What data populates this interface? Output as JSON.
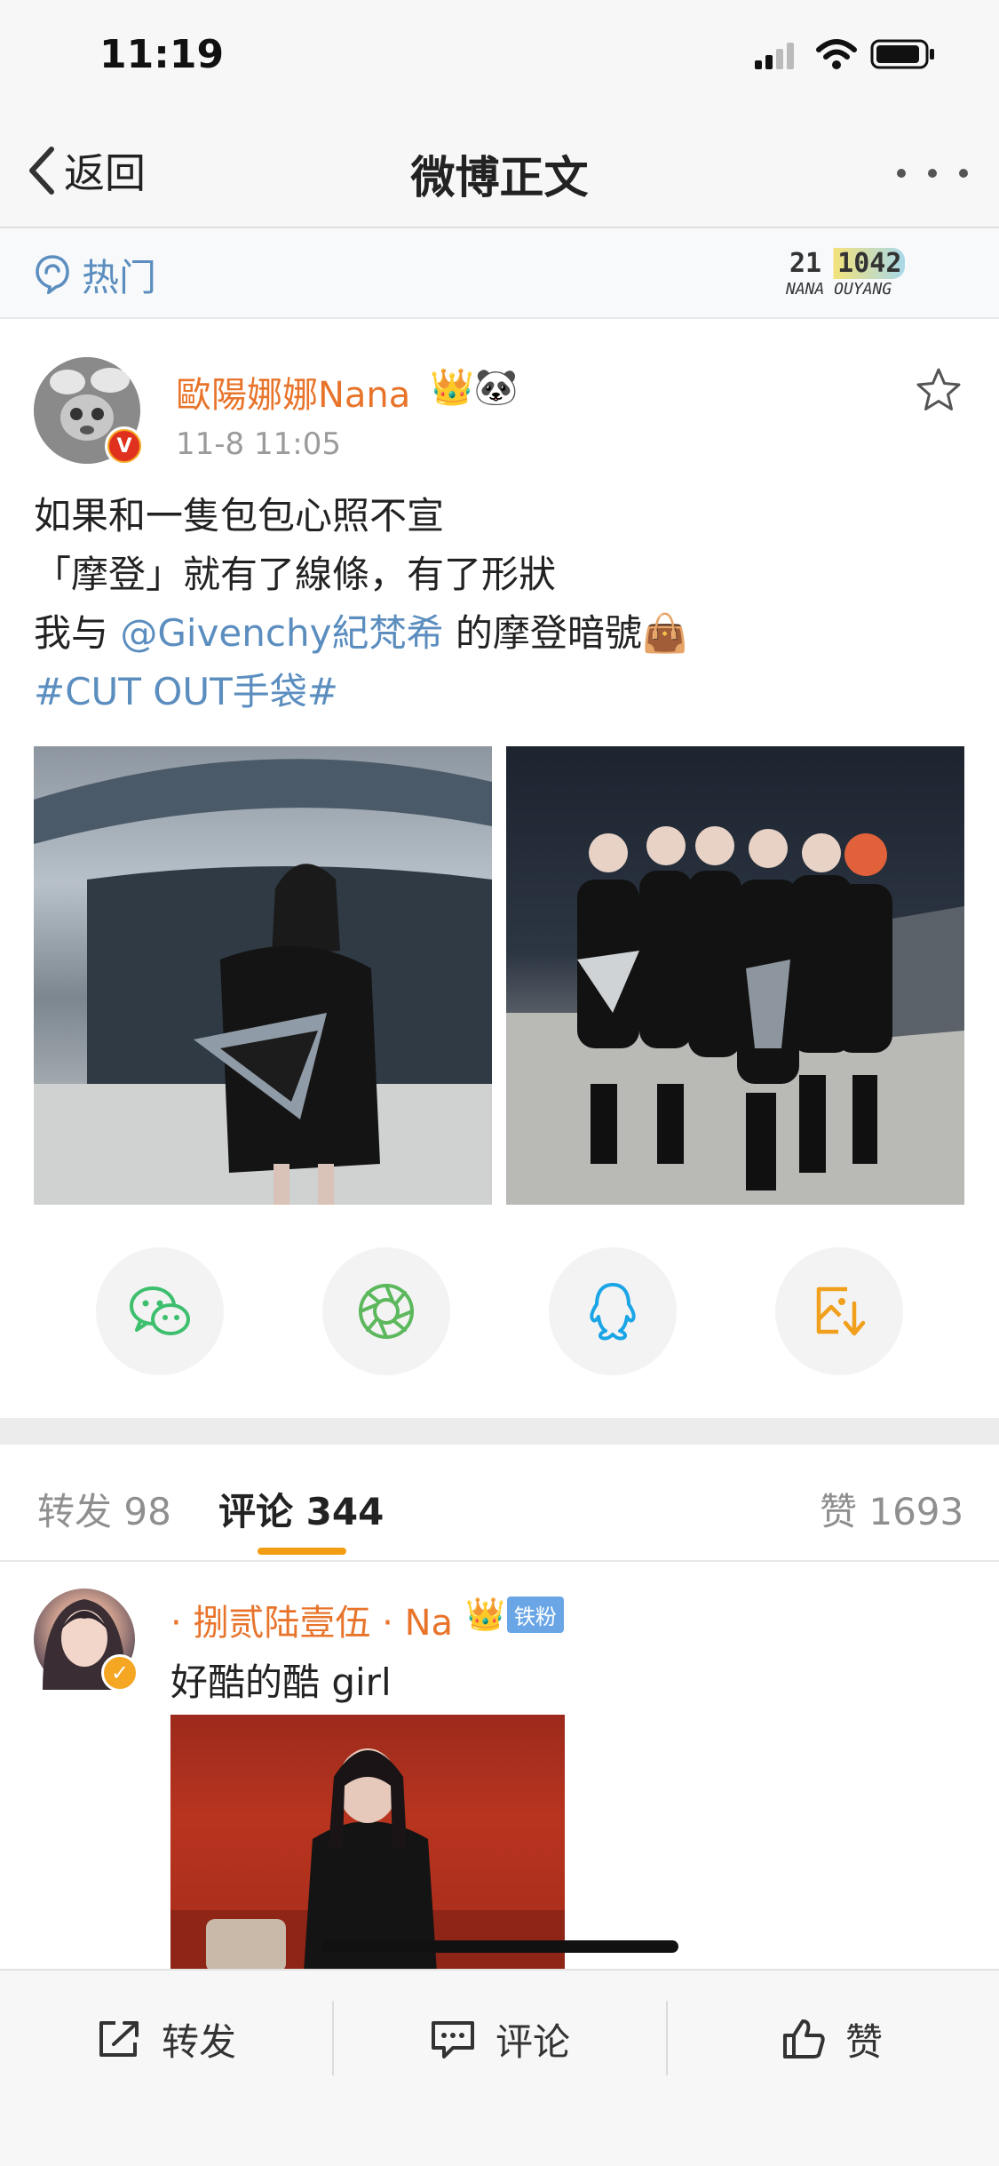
{
  "status_bar": {
    "time": "11:19"
  },
  "nav": {
    "back_label": "返回",
    "title": "微博正文"
  },
  "hot_bar": {
    "label": "热门",
    "badge_top": "21 1042",
    "badge_bottom": "NANA OUYANG"
  },
  "post": {
    "author": "歐陽娜娜Nana",
    "author_icons": "👑🐼",
    "time": "11-8 11:05",
    "line1": "如果和一隻包包心照不宣",
    "line2": "「摩登」就有了線條，有了形狀",
    "line3_prefix": "我与 ",
    "line3_mention": "@Givenchy紀梵希",
    "line3_suffix": " 的摩登暗號👜",
    "hashtag": "#CUT OUT手袋#"
  },
  "tabs": {
    "repost_label": "转发 98",
    "comment_label": "评论 344",
    "like_label": "赞 1693"
  },
  "comment": {
    "name": "· 捌贰陆壹伍 · Na",
    "crown": "👑",
    "fan_badge": "铁粉",
    "text": "好酷的酷 girl"
  },
  "bottom_bar": {
    "repost": "转发",
    "comment": "评论",
    "like": "赞"
  },
  "colors": {
    "accent": "#f39c12",
    "link": "#5b8ebf",
    "name": "#e8742b"
  }
}
